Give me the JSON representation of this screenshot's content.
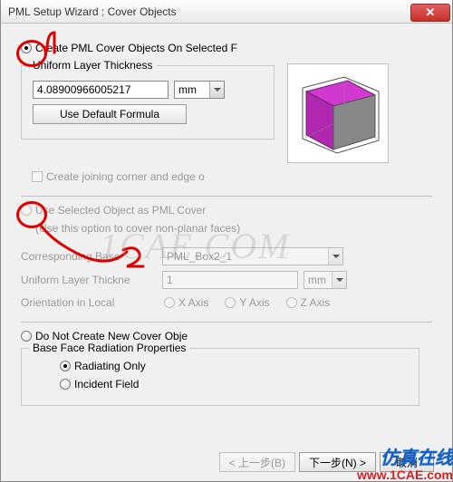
{
  "window": {
    "title": "PML Setup Wizard : Cover Objects",
    "close_glyph": "✕"
  },
  "section1": {
    "radio_label": "Create PML Cover Objects On Selected F",
    "group_title": "Uniform Layer Thickness",
    "thickness_value": "4.08900966005217",
    "thickness_unit": "mm",
    "default_btn": "Use Default Formula",
    "joining_label": "Create joining corner and edge o"
  },
  "section2": {
    "radio_label": "Use Selected Object as PML Cover",
    "sub_note": "(Use this option to cover non-planar faces)",
    "corr_base_label": "Corresponding Base",
    "corr_base_value": "PML_Box2_1",
    "thick_label": "Uniform Layer Thickne",
    "thick_value": "1",
    "thick_unit": "mm",
    "orient_label": "Orientation in Local",
    "orient_x": "X Axis",
    "orient_y": "Y Axis",
    "orient_z": "Z Axis"
  },
  "section3": {
    "radio_label": "Do Not Create New Cover Obje"
  },
  "base_face": {
    "group_title": "Base Face Radiation Properties",
    "radiating": "Radiating Only",
    "incident": "Incident Field"
  },
  "footer": {
    "back": "< 上一步(B)",
    "next": "下一步(N) >",
    "cancel": "取消"
  },
  "annotations": {
    "mark1": "1",
    "mark2": "2"
  },
  "watermark": {
    "text": "1CAE.COM",
    "banner_line1": "仿真在线",
    "banner_line2": "www.1CAE.com"
  }
}
